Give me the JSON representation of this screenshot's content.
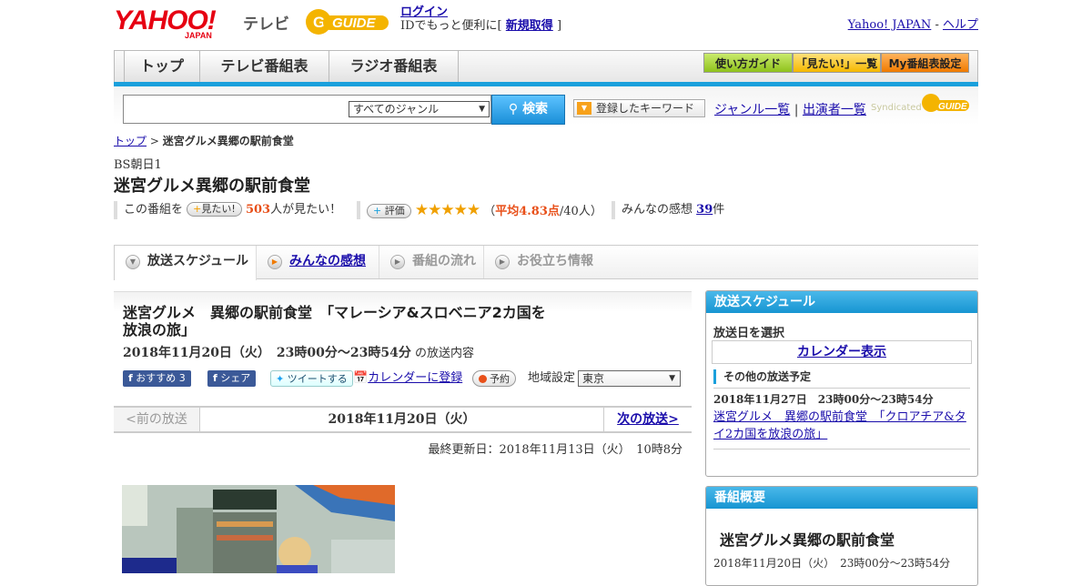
{
  "header": {
    "logo_text": "YAHOO!",
    "logo_sub": "JAPAN",
    "service": "テレビ",
    "gguide_text": "G-GUIDE",
    "login_label": "ログイン",
    "id_text": "IDでもっと便利に[",
    "signup_label": "新規取得",
    "id_close": "]",
    "yahoo_link": "Yahoo! JAPAN",
    "link_sep": "-",
    "help_link": "ヘルプ"
  },
  "nav": {
    "tabs": [
      "トップ",
      "テレビ番組表",
      "ラジオ番組表"
    ],
    "right_buttons": [
      "使い方ガイド",
      "「見たい!」一覧",
      "My番組表設定"
    ]
  },
  "search": {
    "genre_value": "すべてのジャンル",
    "search_button": "検索",
    "keyword_button": "登録したキーワード",
    "genre_list": "ジャンル一覧",
    "link_sep": "|",
    "cast_list": "出演者一覧",
    "syndicated": "Syndicated"
  },
  "breadcrumb": {
    "top": "トップ",
    "sep": ">",
    "current": "迷宮グルメ異郷の駅前食堂"
  },
  "channel": "BS朝日1",
  "program_title": "迷宮グルメ異郷の駅前食堂",
  "stats": {
    "prefix": "この番組を",
    "want_button": "見たい!",
    "want_count": "503",
    "want_suffix": "人が見たい！",
    "rating_button": "評価",
    "stars": "★★★★★",
    "avg_label": "平均4.83点",
    "avg_count": "/40人）",
    "avg_open": "（",
    "review_label": "みんなの感想",
    "review_count": "39",
    "review_suffix": "件"
  },
  "subtabs": [
    "放送スケジュール",
    "みんなの感想",
    "番組の流れ",
    "お役立ち情報"
  ],
  "episode": {
    "title": "迷宮グルメ　異郷の駅前食堂　「マレーシア&スロベニア2カ国を放浪の旅」",
    "date": "2018年11月20日（火）　23時00分～23時54分",
    "date_suffix": "の放送内容",
    "fb_recommend": "おすすめ 3",
    "fb_share": "シェア",
    "tweet": "ツイートする",
    "calendar": "カレンダーに登録",
    "reserve": "予約",
    "region_label": "地域設定",
    "region_value": "東京"
  },
  "pager": {
    "prev": "<前の放送",
    "current": "2018年11月20日（火）",
    "next": "次の放送>"
  },
  "updated": "最終更新日：2018年11月13日（火）　10時8分",
  "sidebar": {
    "schedule_title": "放送スケジュール",
    "select_date": "放送日を選択",
    "calendar_button": "カレンダー表示",
    "other_title": "その他の放送予定",
    "other_date": "2018年11月27日　23時00分～23時54分",
    "other_link": "迷宮グルメ　異郷の駅前食堂　「クロアチア&タイ2カ国を放浪の旅」",
    "summary_title": "番組概要",
    "summary_program": "迷宮グルメ異郷の駅前食堂",
    "summary_date": "2018年11月20日（火）　23時00分～23時54分"
  },
  "colors": {
    "accent": "#1aa0dc",
    "brand_red": "#e60012",
    "star": "#f0a000",
    "want_count": "#e8501a"
  }
}
